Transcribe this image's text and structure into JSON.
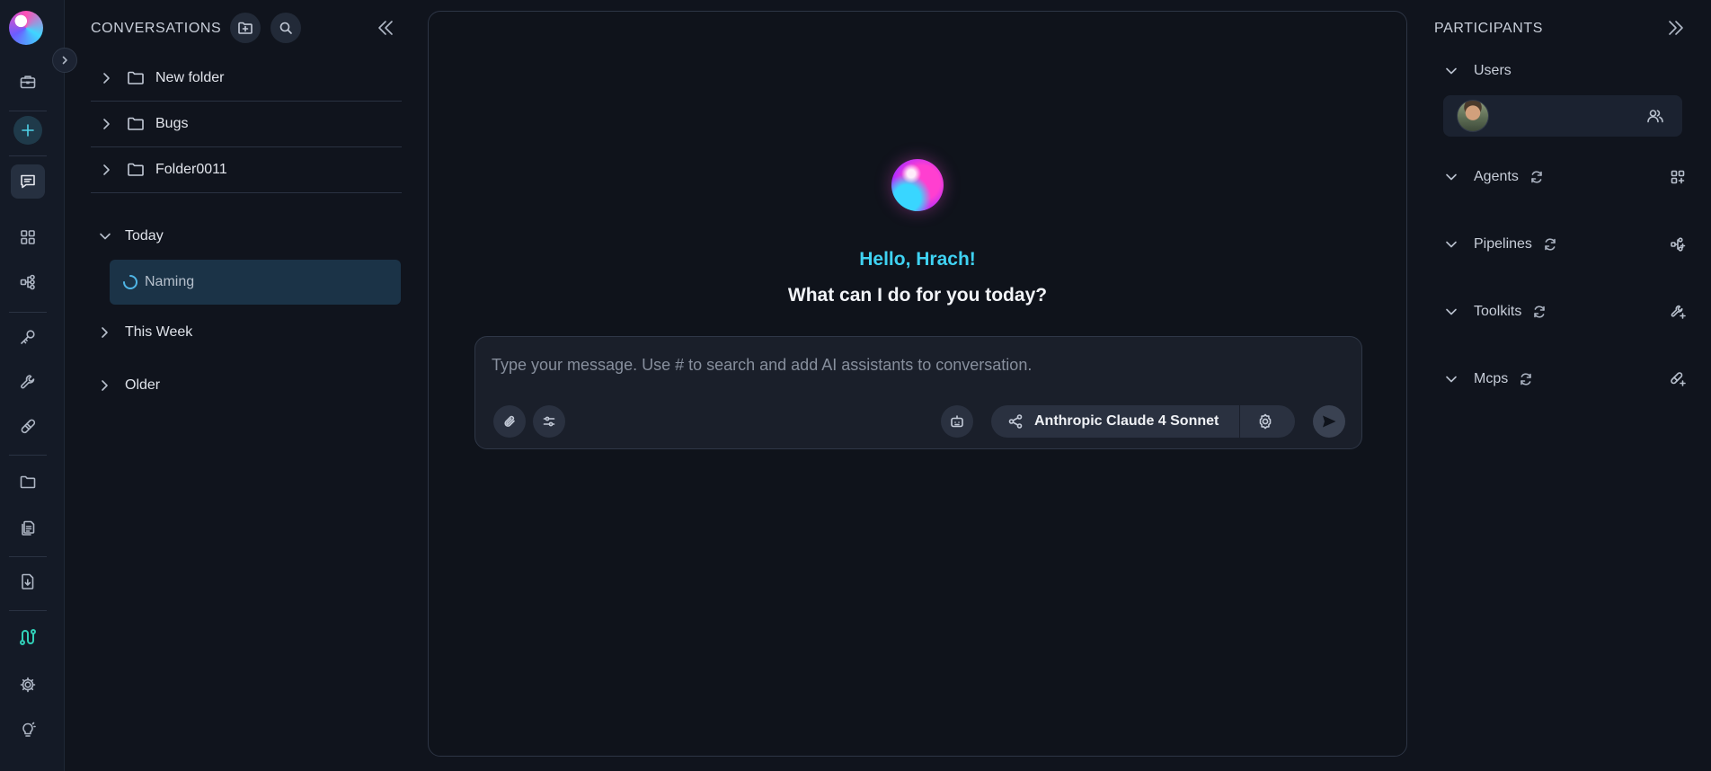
{
  "rail": {
    "items": [
      {
        "name": "logo",
        "icon": "app-logo"
      },
      {
        "name": "briefcase",
        "icon": "briefcase-icon"
      },
      {
        "name": "new-chat",
        "icon": "plus-icon"
      },
      {
        "name": "chat",
        "icon": "chat-icon",
        "active": true
      },
      {
        "name": "apps",
        "icon": "grid-icon"
      },
      {
        "name": "pipelines",
        "icon": "flow-icon"
      },
      {
        "name": "credentials",
        "icon": "key-icon"
      },
      {
        "name": "toolkits",
        "icon": "wrench-icon"
      },
      {
        "name": "mcps",
        "icon": "pill-icon"
      },
      {
        "name": "artifacts",
        "icon": "folder-icon"
      },
      {
        "name": "documents",
        "icon": "documents-icon"
      },
      {
        "name": "import",
        "icon": "file-download-icon"
      },
      {
        "name": "integrations",
        "icon": "route-icon"
      },
      {
        "name": "settings",
        "icon": "gear-icon"
      },
      {
        "name": "ideas",
        "icon": "bulb-icon"
      }
    ]
  },
  "conversations": {
    "title": "CONVERSATIONS",
    "folders": [
      {
        "label": "New folder"
      },
      {
        "label": "Bugs"
      },
      {
        "label": "Folder0011"
      }
    ],
    "groups": {
      "today": "Today",
      "this_week": "This Week",
      "older": "Older"
    },
    "today_items": [
      {
        "label": "Naming"
      }
    ]
  },
  "chat": {
    "greeting": "Hello, Hrach!",
    "question": "What can I do for you today?",
    "input_placeholder": "Type your message. Use # to search and add AI assistants to conversation.",
    "model_label": "Anthropic Claude 4 Sonnet"
  },
  "participants": {
    "title": "PARTICIPANTS",
    "sections": {
      "users": "Users",
      "agents": "Agents",
      "pipelines": "Pipelines",
      "toolkits": "Toolkits",
      "mcps": "Mcps"
    }
  },
  "colors": {
    "accent": "#3fd2f2",
    "background": "#10141d",
    "panel": "#141a26",
    "selected_item": "#1b3347"
  }
}
